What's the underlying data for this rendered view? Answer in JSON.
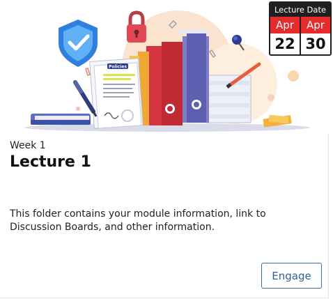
{
  "card": {
    "week_label": "Week 1",
    "title": "Lecture 1",
    "description": "This folder contains your module information, link to Discussion Boards, and other information.",
    "engage_label": "Engage"
  },
  "date_badge": {
    "title": "Lecture Date",
    "start": {
      "month": "Apr",
      "day": "22"
    },
    "end": {
      "month": "Apr",
      "day": "30"
    }
  },
  "illustration": {
    "document_heading": "Policies",
    "icons": [
      "shield-check-icon",
      "padlock-icon",
      "pushpin-icon",
      "pen-icon",
      "paperclip-icon"
    ]
  },
  "colors": {
    "badge_header": "#1f1f1f",
    "badge_month": "#e52b2b",
    "engage_border": "#3c6a9e",
    "engage_text": "#2f5f96"
  }
}
